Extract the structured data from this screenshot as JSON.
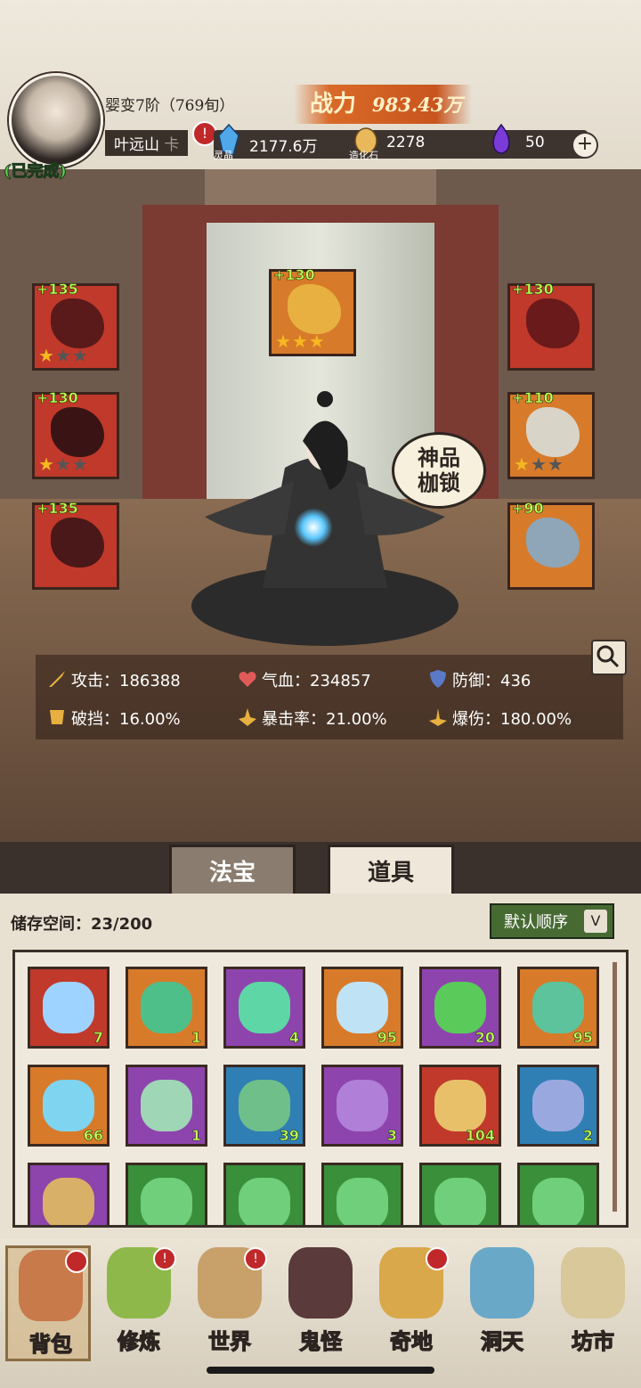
{
  "header": {
    "realm": "婴变7阶（769旬）",
    "player_name": "叶远山",
    "name_tag_obscured": "卡",
    "name_badge": "!",
    "completed_label": "(已完成)",
    "power_label": "战力",
    "power_value": "983.43万",
    "resources": [
      {
        "icon": "spirit-crystal-icon",
        "caption": "灵晶",
        "value": "2177.6万"
      },
      {
        "icon": "creation-stone-icon",
        "caption": "造化石",
        "value": "2278"
      },
      {
        "icon": "purple-flame-icon",
        "caption": "",
        "value": "50"
      }
    ],
    "plus_label": "+"
  },
  "equipment": {
    "left": [
      {
        "level": "+135",
        "stars": 1,
        "color": "red"
      },
      {
        "level": "+130",
        "stars": 1,
        "color": "red"
      },
      {
        "level": "+135",
        "stars": 0,
        "color": "red"
      }
    ],
    "top": {
      "level": "+130",
      "stars": 3,
      "color": "orange"
    },
    "right": [
      {
        "level": "+130",
        "stars": 0,
        "color": "red"
      },
      {
        "level": "+110",
        "stars": 1,
        "color": "orange"
      },
      {
        "level": "+90",
        "stars": 0,
        "color": "orange"
      }
    ],
    "divine_badge": "神品\n枷锁"
  },
  "stats": [
    {
      "icon": "sword-icon",
      "label": "攻击：186388"
    },
    {
      "icon": "heart-icon",
      "label": "气血：234857"
    },
    {
      "icon": "shield-icon",
      "label": "防御：436"
    },
    {
      "icon": "break-block-icon",
      "label": "破挡：16.00%"
    },
    {
      "icon": "crit-rate-icon",
      "label": "暴击率：21.00%"
    },
    {
      "icon": "crit-damage-icon",
      "label": "爆伤：180.00%"
    }
  ],
  "tabs": {
    "artifact": "法宝",
    "items": "道具"
  },
  "inventory": {
    "storage_label": "储存空间：23/200",
    "sort_label": "默认顺序",
    "sort_chevron": "V",
    "items": [
      {
        "qty": "7",
        "color": "red",
        "art": "#9fd3ff"
      },
      {
        "qty": "1",
        "color": "orange",
        "art": "#4fbf8a"
      },
      {
        "qty": "4",
        "color": "purple",
        "art": "#5fd6a6"
      },
      {
        "qty": "95",
        "color": "orange",
        "art": "#bfe3f5"
      },
      {
        "qty": "20",
        "color": "purple",
        "art": "#5acb5a"
      },
      {
        "qty": "95",
        "color": "orange",
        "art": "#5cc39c"
      },
      {
        "qty": "66",
        "color": "orange",
        "art": "#7fd4f0"
      },
      {
        "qty": "1",
        "color": "purple",
        "art": "#9fd6b6"
      },
      {
        "qty": "39",
        "color": "blue",
        "art": "#6fbf8a"
      },
      {
        "qty": "3",
        "color": "purple",
        "art": "#b07fd8"
      },
      {
        "qty": "104",
        "color": "red",
        "art": "#e8c06a"
      },
      {
        "qty": "2",
        "color": "blue",
        "art": "#9aa8e0"
      },
      {
        "qty": "",
        "color": "purple",
        "art": "#d9b067"
      },
      {
        "qty": "",
        "color": "green",
        "art": "#6fcf7a"
      },
      {
        "qty": "",
        "color": "green",
        "art": "#6fcf7a"
      },
      {
        "qty": "",
        "color": "green",
        "art": "#6fcf7a"
      },
      {
        "qty": "",
        "color": "green",
        "art": "#6fcf7a"
      },
      {
        "qty": "",
        "color": "green",
        "art": "#6fcf7a"
      }
    ]
  },
  "nav": [
    {
      "label": "背包",
      "icon": "backpack-icon",
      "badge": ""
    },
    {
      "label": "修炼",
      "icon": "cultivation-icon",
      "badge": "!"
    },
    {
      "label": "世界",
      "icon": "world-scroll-icon",
      "badge": "!"
    },
    {
      "label": "鬼怪",
      "icon": "ghost-icon",
      "badge": ""
    },
    {
      "label": "奇地",
      "icon": "wonderland-icon",
      "badge": ""
    },
    {
      "label": "洞天",
      "icon": "cave-heaven-icon",
      "badge": ""
    },
    {
      "label": "坊市",
      "icon": "market-icon",
      "badge": ""
    }
  ],
  "colors": {
    "slot_red": "#c0392b",
    "slot_orange": "#d77b2b",
    "slot_purple": "#8e44ad",
    "slot_blue": "#2f7fb5",
    "slot_green": "#3a8f3a",
    "accent_green": "#c6ff5a",
    "power_orange": "#d96a28"
  }
}
